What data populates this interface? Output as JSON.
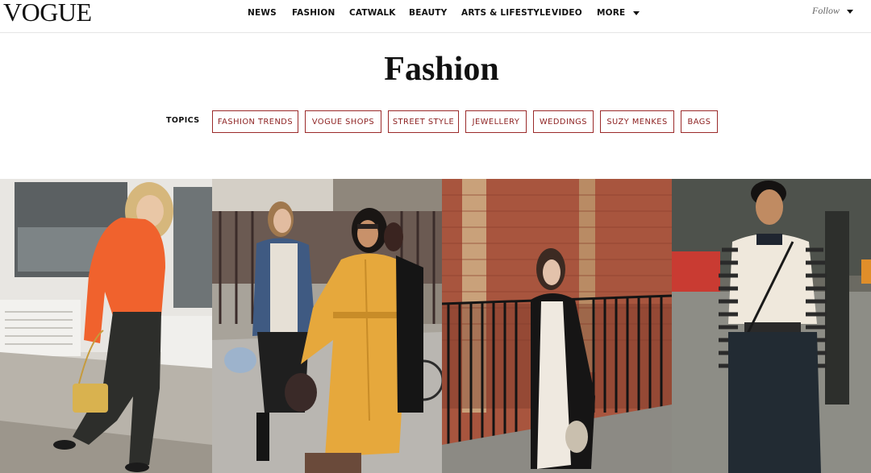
{
  "header": {
    "logo": "VOGUE",
    "nav": [
      "NEWS",
      "FASHION",
      "CATWALK",
      "BEAUTY",
      "ARTS & LIFESTYLE",
      "VIDEO",
      "MORE"
    ],
    "follow_label": "Follow"
  },
  "page": {
    "title": "Fashion"
  },
  "topics": {
    "label": "TOPICS",
    "items": [
      "FASHION TRENDS",
      "VOGUE SHOPS",
      "STREET STYLE",
      "JEWELLERY",
      "WEDDINGS",
      "SUZY MENKES",
      "BAGS"
    ]
  },
  "colors": {
    "accent": "#8c1f1f",
    "text": "#111111",
    "background": "#ffffff"
  },
  "gallery": {
    "photos": [
      {
        "subject": "woman in orange sweater with yellow bag"
      },
      {
        "subject": "two women in denim jacket and yellow trench coat"
      },
      {
        "subject": "woman in black coat and white lace dress by brick wall"
      },
      {
        "subject": "woman in striped sweater with black bag"
      }
    ]
  }
}
